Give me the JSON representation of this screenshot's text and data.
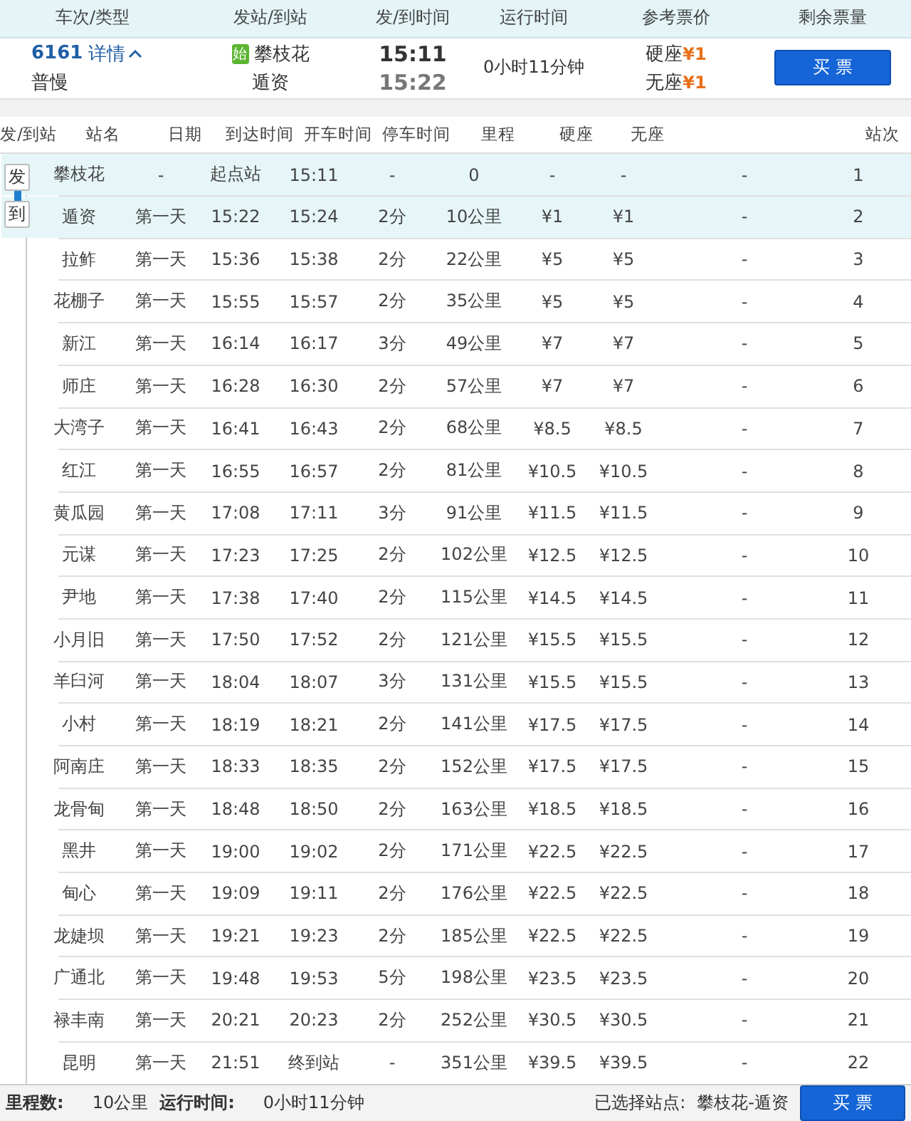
{
  "header": {
    "columns": [
      "车次/类型",
      "发站/到站",
      "发/到时间",
      "运行时间",
      "参考票价",
      "剩余票量"
    ]
  },
  "train": {
    "number": "6161",
    "details_link": "详情",
    "expanded": true,
    "type": "普慢",
    "origin_badge": "始",
    "from": "攀枝花",
    "to": "遁资",
    "depart": "15:11",
    "arrive": "15:22",
    "duration": "0小时11分钟",
    "prices": [
      {
        "seat": "硬座",
        "price": "¥1"
      },
      {
        "seat": "无座",
        "price": "¥1"
      }
    ],
    "button": "买票"
  },
  "stops": {
    "columns": [
      "发/到站",
      "站名",
      "日期",
      "到达时间",
      "开车时间",
      "停车时间",
      "里程",
      "硬座",
      "无座",
      "站次"
    ],
    "rows": [
      {
        "marker": "发",
        "selected": true,
        "name": "攀枝花",
        "date": "-",
        "arrive": "起点站",
        "depart": "15:11",
        "stop": "-",
        "distance": "0",
        "hard_seat": "-",
        "no_seat": "-",
        "column_9": "-",
        "number": "1"
      },
      {
        "marker": "到",
        "selected": true,
        "name": "遁资",
        "date": "第一天",
        "arrive": "15:22",
        "depart": "15:24",
        "stop": "2分",
        "distance": "10公里",
        "hard_seat": "¥1",
        "no_seat": "¥1",
        "column_9": "-",
        "number": "2"
      },
      {
        "selected": false,
        "name": "拉鲊",
        "date": "第一天",
        "arrive": "15:36",
        "depart": "15:38",
        "stop": "2分",
        "distance": "22公里",
        "hard_seat": "¥5",
        "no_seat": "¥5",
        "column_9": "-",
        "number": "3"
      },
      {
        "selected": false,
        "name": "花棚子",
        "date": "第一天",
        "arrive": "15:55",
        "depart": "15:57",
        "stop": "2分",
        "distance": "35公里",
        "hard_seat": "¥5",
        "no_seat": "¥5",
        "column_9": "-",
        "number": "4"
      },
      {
        "selected": false,
        "name": "新江",
        "date": "第一天",
        "arrive": "16:14",
        "depart": "16:17",
        "stop": "3分",
        "distance": "49公里",
        "hard_seat": "¥7",
        "no_seat": "¥7",
        "column_9": "-",
        "number": "5"
      },
      {
        "selected": false,
        "name": "师庄",
        "date": "第一天",
        "arrive": "16:28",
        "depart": "16:30",
        "stop": "2分",
        "distance": "57公里",
        "hard_seat": "¥7",
        "no_seat": "¥7",
        "column_9": "-",
        "number": "6"
      },
      {
        "selected": false,
        "name": "大湾子",
        "date": "第一天",
        "arrive": "16:41",
        "depart": "16:43",
        "stop": "2分",
        "distance": "68公里",
        "hard_seat": "¥8.5",
        "no_seat": "¥8.5",
        "column_9": "-",
        "number": "7"
      },
      {
        "selected": false,
        "name": "红江",
        "date": "第一天",
        "arrive": "16:55",
        "depart": "16:57",
        "stop": "2分",
        "distance": "81公里",
        "hard_seat": "¥10.5",
        "no_seat": "¥10.5",
        "column_9": "-",
        "number": "8"
      },
      {
        "selected": false,
        "name": "黄瓜园",
        "date": "第一天",
        "arrive": "17:08",
        "depart": "17:11",
        "stop": "3分",
        "distance": "91公里",
        "hard_seat": "¥11.5",
        "no_seat": "¥11.5",
        "column_9": "-",
        "number": "9"
      },
      {
        "selected": false,
        "name": "元谋",
        "date": "第一天",
        "arrive": "17:23",
        "depart": "17:25",
        "stop": "2分",
        "distance": "102公里",
        "hard_seat": "¥12.5",
        "no_seat": "¥12.5",
        "column_9": "-",
        "number": "10"
      },
      {
        "selected": false,
        "name": "尹地",
        "date": "第一天",
        "arrive": "17:38",
        "depart": "17:40",
        "stop": "2分",
        "distance": "115公里",
        "hard_seat": "¥14.5",
        "no_seat": "¥14.5",
        "column_9": "-",
        "number": "11"
      },
      {
        "selected": false,
        "name": "小月旧",
        "date": "第一天",
        "arrive": "17:50",
        "depart": "17:52",
        "stop": "2分",
        "distance": "121公里",
        "hard_seat": "¥15.5",
        "no_seat": "¥15.5",
        "column_9": "-",
        "number": "12"
      },
      {
        "selected": false,
        "name": "羊臼河",
        "date": "第一天",
        "arrive": "18:04",
        "depart": "18:07",
        "stop": "3分",
        "distance": "131公里",
        "hard_seat": "¥15.5",
        "no_seat": "¥15.5",
        "column_9": "-",
        "number": "13"
      },
      {
        "selected": false,
        "name": "小村",
        "date": "第一天",
        "arrive": "18:19",
        "depart": "18:21",
        "stop": "2分",
        "distance": "141公里",
        "hard_seat": "¥17.5",
        "no_seat": "¥17.5",
        "column_9": "-",
        "number": "14"
      },
      {
        "selected": false,
        "name": "阿南庄",
        "date": "第一天",
        "arrive": "18:33",
        "depart": "18:35",
        "stop": "2分",
        "distance": "152公里",
        "hard_seat": "¥17.5",
        "no_seat": "¥17.5",
        "column_9": "-",
        "number": "15"
      },
      {
        "selected": false,
        "name": "龙骨甸",
        "date": "第一天",
        "arrive": "18:48",
        "depart": "18:50",
        "stop": "2分",
        "distance": "163公里",
        "hard_seat": "¥18.5",
        "no_seat": "¥18.5",
        "column_9": "-",
        "number": "16"
      },
      {
        "selected": false,
        "name": "黑井",
        "date": "第一天",
        "arrive": "19:00",
        "depart": "19:02",
        "stop": "2分",
        "distance": "171公里",
        "hard_seat": "¥22.5",
        "no_seat": "¥22.5",
        "column_9": "-",
        "number": "17"
      },
      {
        "selected": false,
        "name": "甸心",
        "date": "第一天",
        "arrive": "19:09",
        "depart": "19:11",
        "stop": "2分",
        "distance": "176公里",
        "hard_seat": "¥22.5",
        "no_seat": "¥22.5",
        "column_9": "-",
        "number": "18"
      },
      {
        "selected": false,
        "name": "龙婕坝",
        "date": "第一天",
        "arrive": "19:21",
        "depart": "19:23",
        "stop": "2分",
        "distance": "185公里",
        "hard_seat": "¥22.5",
        "no_seat": "¥22.5",
        "column_9": "-",
        "number": "19"
      },
      {
        "selected": false,
        "name": "广通北",
        "date": "第一天",
        "arrive": "19:48",
        "depart": "19:53",
        "stop": "5分",
        "distance": "198公里",
        "hard_seat": "¥23.5",
        "no_seat": "¥23.5",
        "column_9": "-",
        "number": "20"
      },
      {
        "selected": false,
        "name": "禄丰南",
        "date": "第一天",
        "arrive": "20:21",
        "depart": "20:23",
        "stop": "2分",
        "distance": "252公里",
        "hard_seat": "¥30.5",
        "no_seat": "¥30.5",
        "column_9": "-",
        "number": "21"
      },
      {
        "selected": false,
        "name": "昆明",
        "date": "第一天",
        "arrive": "21:51",
        "depart": "终到站",
        "stop": "-",
        "distance": "351公里",
        "hard_seat": "¥39.5",
        "no_seat": "¥39.5",
        "column_9": "-",
        "number": "22"
      }
    ]
  },
  "footer": {
    "distance_label": "里程数:",
    "distance": "10公里",
    "duration_label": "运行时间:",
    "duration": "0小时11分钟",
    "selected_label": "已选择站点:",
    "selected_stations": "攀枝花-遁资",
    "button": "买票"
  }
}
